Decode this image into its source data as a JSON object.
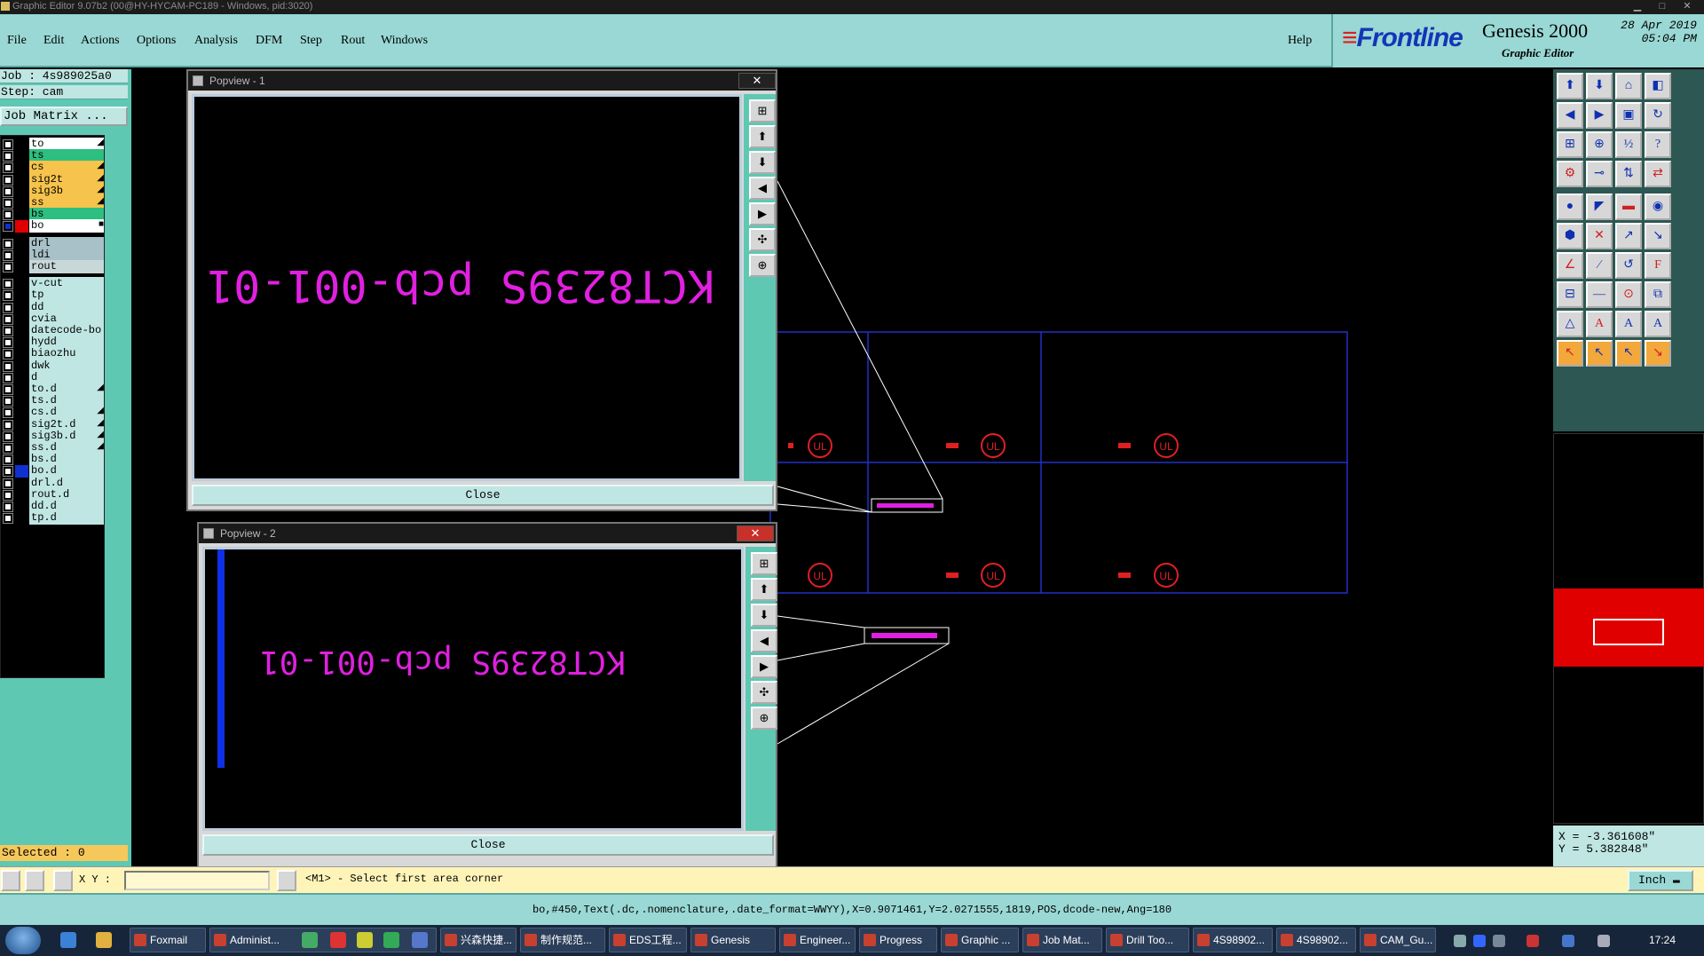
{
  "window": {
    "title": "Graphic Editor 9.07b2 (00@HY-HYCAM-PC189 - Windows, pid:3020)"
  },
  "menu": [
    {
      "label": "File"
    },
    {
      "label": "Edit"
    },
    {
      "label": "Actions"
    },
    {
      "label": "Options"
    },
    {
      "label": "Analysis"
    },
    {
      "label": "DFM"
    },
    {
      "label": "Step"
    },
    {
      "label": "Rout"
    },
    {
      "label": "Windows"
    }
  ],
  "help_label": "Help",
  "brand": {
    "logo": "Frontline",
    "product": "Genesis 2000",
    "subtitle": "Graphic Editor",
    "date": "28 Apr 2019",
    "time": "05:04 PM"
  },
  "job": {
    "job_line": "Job : 4s989025a0",
    "step_line": "Step: cam",
    "matrix_button": "Job Matrix ..."
  },
  "layers": [
    {
      "name": "to",
      "color": "#ffffff",
      "mark": "◢"
    },
    {
      "name": "ts",
      "color": "#2dbf80",
      "mark": ""
    },
    {
      "name": "cs",
      "color": "#f6c34c",
      "mark": "◢"
    },
    {
      "name": "sig2t",
      "color": "#f6c34c",
      "mark": "◢"
    },
    {
      "name": "sig3b",
      "color": "#f6c34c",
      "mark": "◢"
    },
    {
      "name": "ss",
      "color": "#f6c34c",
      "mark": "◢"
    },
    {
      "name": "bs",
      "color": "#2dbf80",
      "mark": ""
    },
    {
      "name": "bo",
      "color": "#ffffff",
      "mark": "■",
      "active": true
    },
    {
      "name": "drl",
      "color": "#a8c0c8",
      "mark": ""
    },
    {
      "name": "ldi",
      "color": "#a8c0c8",
      "mark": ""
    },
    {
      "name": "rout",
      "color": "#c8d8d8",
      "mark": ""
    },
    {
      "name": "v-cut",
      "color": "#bfe6e2",
      "mark": ""
    },
    {
      "name": "tp",
      "color": "#bfe6e2",
      "mark": ""
    },
    {
      "name": "dd",
      "color": "#bfe6e2",
      "mark": ""
    },
    {
      "name": "cvia",
      "color": "#bfe6e2",
      "mark": ""
    },
    {
      "name": "datecode-bo",
      "color": "#bfe6e2",
      "mark": ""
    },
    {
      "name": "hydd",
      "color": "#bfe6e2",
      "mark": ""
    },
    {
      "name": "biaozhu",
      "color": "#bfe6e2",
      "mark": ""
    },
    {
      "name": "dwk",
      "color": "#bfe6e2",
      "mark": ""
    },
    {
      "name": "d",
      "color": "#bfe6e2",
      "mark": ""
    },
    {
      "name": "to.d",
      "color": "#bfe6e2",
      "mark": "◢"
    },
    {
      "name": "ts.d",
      "color": "#bfe6e2",
      "mark": ""
    },
    {
      "name": "cs.d",
      "color": "#bfe6e2",
      "mark": "◢"
    },
    {
      "name": "sig2t.d",
      "color": "#bfe6e2",
      "mark": "◢"
    },
    {
      "name": "sig3b.d",
      "color": "#bfe6e2",
      "mark": "◢"
    },
    {
      "name": "ss.d",
      "color": "#bfe6e2",
      "mark": "◢"
    },
    {
      "name": "bs.d",
      "color": "#bfe6e2",
      "mark": ""
    },
    {
      "name": "bo.d",
      "color": "#bfe6e2",
      "mark": "",
      "swatch": "#1030d0"
    },
    {
      "name": "drl.d",
      "color": "#bfe6e2",
      "mark": ""
    },
    {
      "name": "rout.d",
      "color": "#bfe6e2",
      "mark": ""
    },
    {
      "name": "dd.d",
      "color": "#bfe6e2",
      "mark": ""
    },
    {
      "name": "tp.d",
      "color": "#bfe6e2",
      "mark": ""
    }
  ],
  "selected_label": "Selected : 0",
  "popview1": {
    "title": "Popview - 1",
    "text": "KCT8239S pcb-001-01",
    "close_label": "Close",
    "close_x": "✕"
  },
  "popview2": {
    "title": "Popview - 2",
    "text": "KCT8239S pcb-001-01",
    "close_label": "Close",
    "close_x": "✕"
  },
  "coords": {
    "x": "X = -3.361608\"",
    "y": "Y = 5.382848\""
  },
  "cmd": {
    "xy_label": "X Y :",
    "prompt": "<M1> - Select first area corner",
    "unit": "Inch"
  },
  "info_line": "bo,#450,Text(.dc,.nomenclature,.date_format=WWYY),X=0.9071461,Y=2.0271555,1819,POS,dcode-new,Ang=180",
  "taskbar": {
    "tasks": [
      "Foxmail",
      "Administ...",
      "兴森快捷...",
      "制作规范...",
      "EDS工程...",
      "Genesis",
      "Engineer...",
      "Progress",
      "Graphic ...",
      "Job Mat...",
      "Drill Too...",
      "4S98902...",
      "4S98902...",
      "CAM_Gu..."
    ],
    "clock": "17:24"
  },
  "icons": {
    "toolbar": "toolbar-icons",
    "brand": "frontline-logo"
  },
  "colors": {
    "menu_bg": "#99d8d4",
    "panel_bg": "#5ec8b3",
    "layer_text": "#e020e0",
    "board_outline": "#2030c8",
    "ul_logo": "#e02020"
  }
}
